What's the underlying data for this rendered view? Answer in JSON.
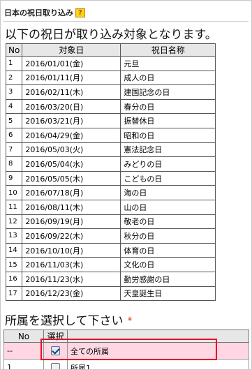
{
  "title": {
    "text": "日本の祝日取り込み",
    "help": "?"
  },
  "heading": "以下の祝日が取り込み対象となります。",
  "holidays": {
    "headers": {
      "no": "No",
      "date": "対象日",
      "name": "祝日名称"
    },
    "rows": [
      {
        "no": "1",
        "date": "2016/01/01(金)",
        "name": "元旦"
      },
      {
        "no": "2",
        "date": "2016/01/11(月)",
        "name": "成人の日"
      },
      {
        "no": "3",
        "date": "2016/02/11(木)",
        "name": "建国記念の日"
      },
      {
        "no": "4",
        "date": "2016/03/20(日)",
        "name": "春分の日"
      },
      {
        "no": "5",
        "date": "2016/03/21(月)",
        "name": "振替休日"
      },
      {
        "no": "6",
        "date": "2016/04/29(金)",
        "name": "昭和の日"
      },
      {
        "no": "7",
        "date": "2016/05/03(火)",
        "name": "憲法記念日"
      },
      {
        "no": "8",
        "date": "2016/05/04(水)",
        "name": "みどりの日"
      },
      {
        "no": "9",
        "date": "2016/05/05(木)",
        "name": "こどもの日"
      },
      {
        "no": "10",
        "date": "2016/07/18(月)",
        "name": "海の日"
      },
      {
        "no": "11",
        "date": "2016/08/11(木)",
        "name": "山の日"
      },
      {
        "no": "12",
        "date": "2016/09/19(月)",
        "name": "敬老の日"
      },
      {
        "no": "13",
        "date": "2016/09/22(木)",
        "name": "秋分の日"
      },
      {
        "no": "14",
        "date": "2016/10/10(月)",
        "name": "体育の日"
      },
      {
        "no": "15",
        "date": "2016/11/03(木)",
        "name": "文化の日"
      },
      {
        "no": "16",
        "date": "2016/11/23(水)",
        "name": "勤労感謝の日"
      },
      {
        "no": "17",
        "date": "2016/12/23(金)",
        "name": "天皇誕生日"
      }
    ]
  },
  "department": {
    "heading": "所属を選択して下さい",
    "required_mark": "*",
    "headers": {
      "no": "No",
      "select": "選択"
    },
    "rows": [
      {
        "no": "--",
        "checked": true,
        "name": "全ての所属"
      },
      {
        "no": "1",
        "checked": false,
        "name": "所属1"
      }
    ]
  },
  "colors": {
    "highlight": "#e2102a",
    "all_row_bg": "#ffd6e1",
    "help_bg": "#ffd21a",
    "required": "#e03a1e"
  }
}
